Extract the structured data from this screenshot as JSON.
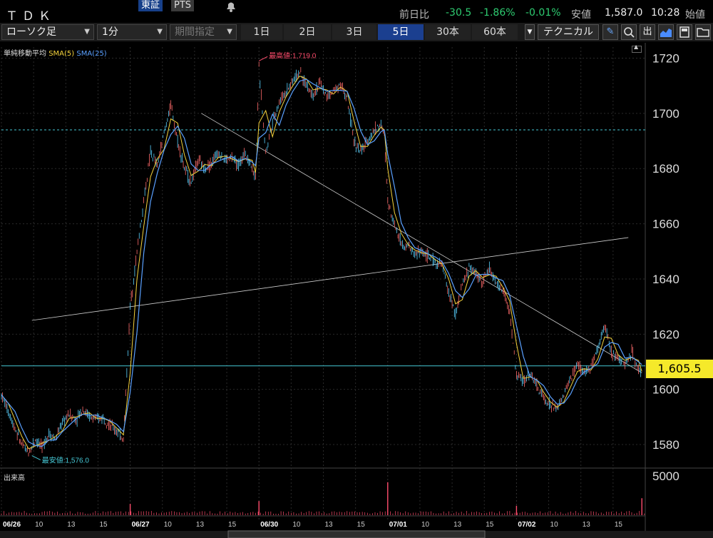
{
  "header": {
    "ticker": "ＴＤＫ",
    "exchange_active": "東証",
    "exchange_other": "PTS",
    "change_label": "前日比",
    "change_value": "-30.5",
    "change_pct": "-1.86%",
    "extra_pct": "-0.01%",
    "low_label": "安値",
    "low_value": "1,587.0",
    "time": "10:28",
    "open_label": "始値"
  },
  "toolbar": {
    "chart_type": "ローソク足",
    "interval": "1分",
    "period": "期間指定",
    "ranges": [
      "1日",
      "2日",
      "3日",
      "5日",
      "30本",
      "60本"
    ],
    "active_range": "5日",
    "technical": "テクニカル",
    "icons": [
      "pen-icon",
      "zoom-icon",
      "volume-icon",
      "chart-icon",
      "save-icon",
      "folder-icon"
    ],
    "volume_icon_text": "出"
  },
  "legend": {
    "title": "単純移動平均",
    "sma5": "SMA(5)",
    "sma25": "SMA(25)"
  },
  "annotations": {
    "high": "最高値:1,719.0",
    "low": "最安値:1,576.0"
  },
  "volume_label": "出来高",
  "current_price": "1,605.5",
  "colors": {
    "background": "#000000",
    "grid": "#2a2a2a",
    "sma5": "#f5d33c",
    "sma25": "#5aa0ff",
    "up": "#ff6b6b",
    "down": "#5ad2ff",
    "price_tag": "#f5e92a",
    "horizontal_line": "#46c8d6",
    "trend_line": "#cccccc",
    "high_marker": "#ff4d6d",
    "low_marker": "#46c8d6",
    "volume_bar": "#ff4d6d"
  },
  "chart_data": {
    "type": "line",
    "y_ticks": [
      "1720",
      "1700",
      "1680",
      "1660",
      "1640",
      "1620",
      "1600",
      "1580"
    ],
    "volume_ticks": [
      "5000"
    ],
    "ylim": [
      1572,
      1724
    ],
    "x_labels": [
      "06/26",
      "10",
      "13",
      "15",
      "06/27",
      "10",
      "13",
      "15",
      "06/30",
      "10",
      "13",
      "15",
      "07/01",
      "10",
      "13",
      "15",
      "07/02",
      "10",
      "13",
      "15"
    ],
    "days": [
      "06/26",
      "06/27",
      "06/30",
      "07/01",
      "07/02"
    ],
    "day_separators_after": [
      3,
      7,
      11,
      15
    ],
    "price_path": [
      [
        0,
        1598
      ],
      [
        4,
        1592
      ],
      [
        8,
        1586
      ],
      [
        12,
        1580
      ],
      [
        16,
        1577
      ],
      [
        20,
        1582
      ],
      [
        24,
        1579
      ],
      [
        28,
        1584
      ],
      [
        32,
        1582
      ],
      [
        36,
        1588
      ],
      [
        40,
        1591
      ],
      [
        44,
        1589
      ],
      [
        48,
        1593
      ],
      [
        52,
        1590
      ],
      [
        56,
        1589
      ],
      [
        60,
        1590
      ],
      [
        64,
        1587
      ],
      [
        68,
        1585
      ],
      [
        72,
        1582
      ],
      [
        76,
        1630
      ],
      [
        80,
        1650
      ],
      [
        84,
        1668
      ],
      [
        88,
        1686
      ],
      [
        92,
        1681
      ],
      [
        96,
        1693
      ],
      [
        100,
        1703
      ],
      [
        104,
        1690
      ],
      [
        108,
        1680
      ],
      [
        112,
        1675
      ],
      [
        116,
        1683
      ],
      [
        120,
        1680
      ],
      [
        124,
        1682
      ],
      [
        128,
        1686
      ],
      [
        132,
        1683
      ],
      [
        136,
        1684
      ],
      [
        140,
        1681
      ],
      [
        144,
        1686
      ],
      [
        148,
        1680
      ],
      [
        150,
        1677
      ],
      [
        152,
        1716
      ],
      [
        156,
        1686
      ],
      [
        160,
        1697
      ],
      [
        164,
        1704
      ],
      [
        168,
        1708
      ],
      [
        172,
        1712
      ],
      [
        176,
        1715
      ],
      [
        180,
        1710
      ],
      [
        184,
        1707
      ],
      [
        188,
        1711
      ],
      [
        192,
        1706
      ],
      [
        196,
        1708
      ],
      [
        200,
        1711
      ],
      [
        204,
        1705
      ],
      [
        208,
        1690
      ],
      [
        212,
        1686
      ],
      [
        216,
        1690
      ],
      [
        220,
        1694
      ],
      [
        224,
        1696
      ],
      [
        226,
        1692
      ],
      [
        228,
        1668
      ],
      [
        232,
        1660
      ],
      [
        236,
        1653
      ],
      [
        240,
        1652
      ],
      [
        244,
        1649
      ],
      [
        248,
        1650
      ],
      [
        252,
        1648
      ],
      [
        256,
        1646
      ],
      [
        260,
        1645
      ],
      [
        264,
        1635
      ],
      [
        268,
        1627
      ],
      [
        272,
        1638
      ],
      [
        276,
        1644
      ],
      [
        280,
        1642
      ],
      [
        284,
        1639
      ],
      [
        288,
        1644
      ],
      [
        292,
        1638
      ],
      [
        296,
        1636
      ],
      [
        300,
        1628
      ],
      [
        304,
        1605
      ],
      [
        308,
        1603
      ],
      [
        312,
        1606
      ],
      [
        316,
        1601
      ],
      [
        320,
        1597
      ],
      [
        324,
        1594
      ],
      [
        328,
        1593
      ],
      [
        332,
        1598
      ],
      [
        336,
        1604
      ],
      [
        340,
        1609
      ],
      [
        344,
        1606
      ],
      [
        348,
        1608
      ],
      [
        352,
        1614
      ],
      [
        356,
        1624
      ],
      [
        360,
        1613
      ],
      [
        364,
        1612
      ],
      [
        368,
        1609
      ],
      [
        372,
        1614
      ],
      [
        376,
        1607
      ],
      [
        378,
        1606
      ]
    ],
    "high_value": 1719.0,
    "low_value": 1576.0,
    "current_value": 1605.5,
    "horizontal_lines": [
      1694,
      1608.5
    ],
    "trend_lines": [
      {
        "from": [
          18,
          1625
        ],
        "to": [
          370,
          1655
        ]
      },
      {
        "from": [
          118,
          1700
        ],
        "to": [
          378,
          1606
        ]
      }
    ],
    "volume_spikes": [
      {
        "x": 76,
        "value": 1200
      },
      {
        "x": 152,
        "value": 1500
      },
      {
        "x": 228,
        "value": 3500
      },
      {
        "x": 304,
        "value": 1000
      },
      {
        "x": 378,
        "value": 1800
      }
    ]
  }
}
